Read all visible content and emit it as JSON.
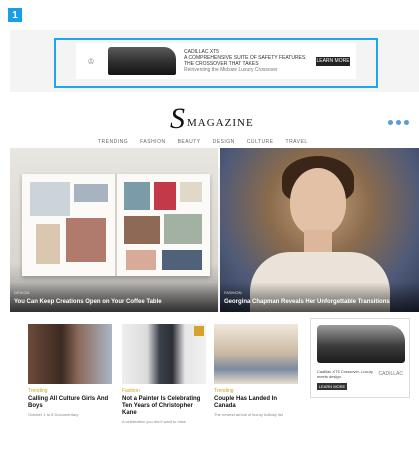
{
  "step": {
    "number": "1"
  },
  "ad_banner": {
    "brand_mark": "♔",
    "headline": "CADILLAC XT5",
    "body": "A COMPREHENSIVE SUITE OF SAFETY FEATURES. THE CROSSOVER THAT TAKES",
    "highlight": "Reinventing the Midsize Luxury Crossover",
    "cta_label": "LEARN MORE"
  },
  "header": {
    "logo_letter": "S",
    "logo_word": "MAGAZINE",
    "nav": [
      "TRENDING",
      "FASHION",
      "BEAUTY",
      "DESIGN",
      "CULTURE",
      "TRAVEL"
    ]
  },
  "hero": {
    "left": {
      "category": "DESIGN",
      "title": "You Can Keep Creations Open on Your Coffee Table"
    },
    "right": {
      "category": "FASHION",
      "title": "Georgina Chapman Reveals Her Unforgettable Transitions"
    }
  },
  "cards": [
    {
      "category": "Trending",
      "title": "Calling All Culture Girls And Boys",
      "sub": "October 1 to 8 Documentary"
    },
    {
      "category": "Fashion",
      "title": "Not a Painter Is Celebrating Ten Years of Christopher Kane",
      "sub": "A celebration you don't want to miss"
    },
    {
      "category": "Trending",
      "title": "Couple Has Landed In Canada",
      "sub": "The newest arrival of luxury holiday list"
    }
  ],
  "sidebar_ad": {
    "text": "Cadillac XT5 Crossover. Luxury meets design.",
    "cta_label": "LEARN MORE",
    "brand": "CADILLAC"
  }
}
